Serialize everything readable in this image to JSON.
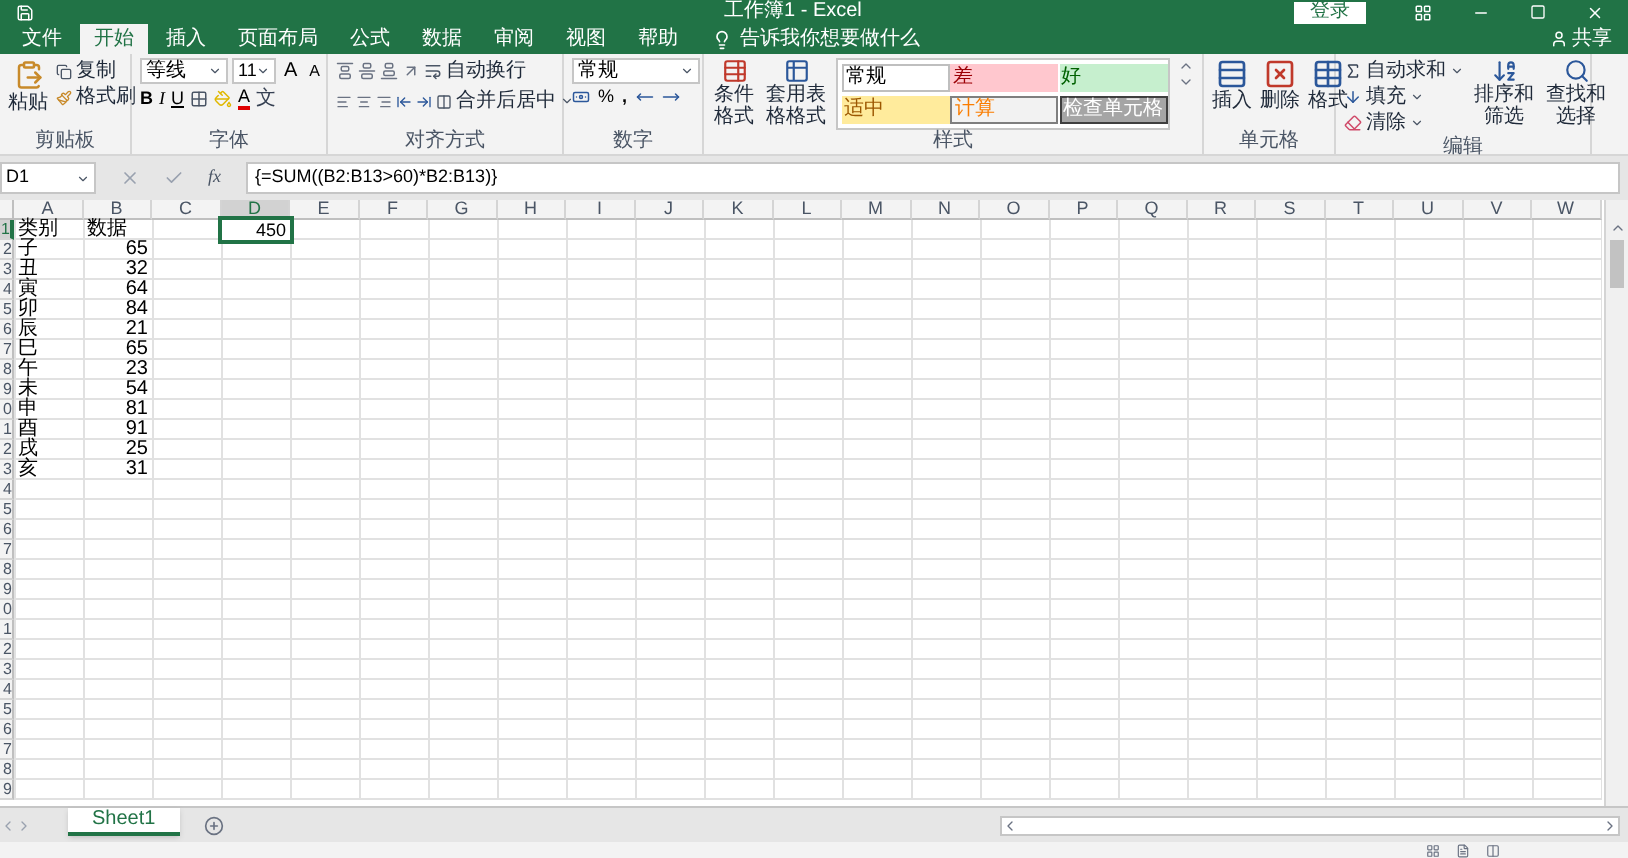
{
  "title_bar": {
    "title": "工作簿1 - Excel",
    "sign_in": "登录"
  },
  "ribbon_tabs": [
    {
      "label": "文件",
      "selected": false
    },
    {
      "label": "开始",
      "selected": true
    },
    {
      "label": "插入",
      "selected": false
    },
    {
      "label": "页面布局",
      "selected": false
    },
    {
      "label": "公式",
      "selected": false
    },
    {
      "label": "数据",
      "selected": false
    },
    {
      "label": "审阅",
      "selected": false
    },
    {
      "label": "视图",
      "selected": false
    },
    {
      "label": "帮助",
      "selected": false
    }
  ],
  "tell_me": "告诉我你想要做什么",
  "share": "共享",
  "ribbon": {
    "clipboard": {
      "paste": "粘贴",
      "copy": "复制",
      "format_painter": "格式刷",
      "label": "剪贴板"
    },
    "font": {
      "font_name": "等线",
      "font_size": "11",
      "grow": "A",
      "shrink": "A",
      "bold": "B",
      "italic": "I",
      "underline": "U",
      "font_color": "A",
      "phonetic": "文",
      "label": "字体"
    },
    "alignment": {
      "wrap": "自动换行",
      "merge": "合并后居中",
      "label": "对齐方式"
    },
    "number": {
      "format": "常规",
      "percent": "%",
      "comma": ",",
      "label": "数字"
    },
    "styles": {
      "conditional": "条件格式",
      "table": "套用表格格式",
      "label": "样式",
      "cells": [
        {
          "label": "常规",
          "kind": "normal"
        },
        {
          "label": "差",
          "kind": "bad"
        },
        {
          "label": "好",
          "kind": "good"
        },
        {
          "label": "适中",
          "kind": "neutral"
        },
        {
          "label": "计算",
          "kind": "calculation"
        },
        {
          "label": "检查单元格",
          "kind": "check"
        }
      ]
    },
    "cells": {
      "insert": "插入",
      "delete": "删除",
      "format": "格式",
      "label": "单元格"
    },
    "editing": {
      "autosum": "自动求和",
      "fill": "填充",
      "clear": "清除",
      "sort": "排序和筛选",
      "find": "查找和选择",
      "label": "编辑"
    }
  },
  "formula_bar": {
    "name_box": "D1",
    "fx": "fx",
    "formula": "{=SUM((B2:B13>60)*B2:B13)}"
  },
  "sheet": {
    "columns": [
      {
        "label": "A",
        "selected": false
      },
      {
        "label": "B",
        "selected": false
      },
      {
        "label": "C",
        "selected": false
      },
      {
        "label": "D",
        "selected": true
      },
      {
        "label": "E",
        "selected": false
      },
      {
        "label": "F",
        "selected": false
      },
      {
        "label": "G",
        "selected": false
      },
      {
        "label": "H",
        "selected": false
      },
      {
        "label": "I",
        "selected": false
      },
      {
        "label": "J",
        "selected": false
      },
      {
        "label": "K",
        "selected": false
      },
      {
        "label": "L",
        "selected": false
      },
      {
        "label": "M",
        "selected": false
      },
      {
        "label": "N",
        "selected": false
      },
      {
        "label": "O",
        "selected": false
      },
      {
        "label": "P",
        "selected": false
      },
      {
        "label": "Q",
        "selected": false
      },
      {
        "label": "R",
        "selected": false
      },
      {
        "label": "S",
        "selected": false
      },
      {
        "label": "T",
        "selected": false
      },
      {
        "label": "U",
        "selected": false
      },
      {
        "label": "V",
        "selected": false
      },
      {
        "label": "W",
        "selected": false
      }
    ],
    "active_cell": {
      "value": "450"
    },
    "rows": [
      {
        "header": "1",
        "selected": true,
        "category": "类别",
        "amount": "数据"
      },
      {
        "header": "2",
        "selected": false,
        "category": "子",
        "amount": "65"
      },
      {
        "header": "3",
        "selected": false,
        "category": "丑",
        "amount": "32"
      },
      {
        "header": "4",
        "selected": false,
        "category": "寅",
        "amount": "64"
      },
      {
        "header": "5",
        "selected": false,
        "category": "卯",
        "amount": "84"
      },
      {
        "header": "6",
        "selected": false,
        "category": "辰",
        "amount": "21"
      },
      {
        "header": "7",
        "selected": false,
        "category": "巳",
        "amount": "65"
      },
      {
        "header": "8",
        "selected": false,
        "category": "午",
        "amount": "23"
      },
      {
        "header": "9",
        "selected": false,
        "category": "未",
        "amount": "54"
      },
      {
        "header": "0",
        "selected": false,
        "category": "申",
        "amount": "81"
      },
      {
        "header": "1",
        "selected": false,
        "category": "酉",
        "amount": "91"
      },
      {
        "header": "2",
        "selected": false,
        "category": "戌",
        "amount": "25"
      },
      {
        "header": "3",
        "selected": false,
        "category": "亥",
        "amount": "31"
      },
      {
        "header": "4",
        "selected": false
      },
      {
        "header": "5",
        "selected": false
      },
      {
        "header": "6",
        "selected": false
      },
      {
        "header": "7",
        "selected": false
      },
      {
        "header": "8",
        "selected": false
      },
      {
        "header": "9",
        "selected": false
      },
      {
        "header": "0",
        "selected": false
      },
      {
        "header": "1",
        "selected": false
      },
      {
        "header": "2",
        "selected": false
      },
      {
        "header": "3",
        "selected": false
      },
      {
        "header": "4",
        "selected": false
      },
      {
        "header": "5",
        "selected": false
      },
      {
        "header": "6",
        "selected": false
      },
      {
        "header": "7",
        "selected": false
      },
      {
        "header": "8",
        "selected": false
      },
      {
        "header": "9",
        "selected": false
      }
    ]
  },
  "sheet_tabs": [
    {
      "label": "Sheet1",
      "selected": true
    }
  ]
}
